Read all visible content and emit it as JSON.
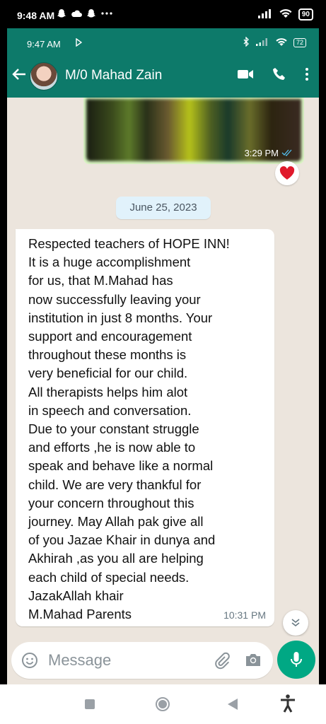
{
  "outer_status": {
    "time": "9:48 AM",
    "icons": [
      "snapchat-icon",
      "cloud-icon",
      "snapchat-icon",
      "more-dots-icon"
    ],
    "battery": "90"
  },
  "inner_status": {
    "time": "9:47 AM",
    "battery": "72"
  },
  "header": {
    "contact_name": "M/0 Mahad Zain"
  },
  "image_message": {
    "time": "3:29 PM",
    "reaction": "❤️"
  },
  "date_chip": "June 25, 2023",
  "message": {
    "lines": [
      "Respected teachers of HOPE INN!",
      "It is a huge accomplishment",
      "for us, that M.Mahad has",
      "now successfully leaving your",
      "institution in just 8 months. Your",
      "support and encouragement",
      "throughout these months is",
      "very beneficial for our child.",
      "All therapists helps him alot",
      "in speech and conversation.",
      "Due to your constant struggle",
      "and efforts ,he is now able to",
      "speak and behave like a normal",
      "child. We are very thankful for",
      "your concern throughout this",
      "journey. May Allah pak give all",
      "of you Jazae Khair in dunya and",
      "Akhirah ,as you all are helping",
      "each child of special needs.",
      "JazakAllah khair",
      "M.Mahad Parents"
    ],
    "time": "10:31 PM"
  },
  "composer": {
    "placeholder": "Message"
  },
  "colors": {
    "header": "#0d7a6a",
    "chat_bg": "#ece5dd",
    "mic": "#00a884",
    "outgoing": "#dcf8c6"
  }
}
